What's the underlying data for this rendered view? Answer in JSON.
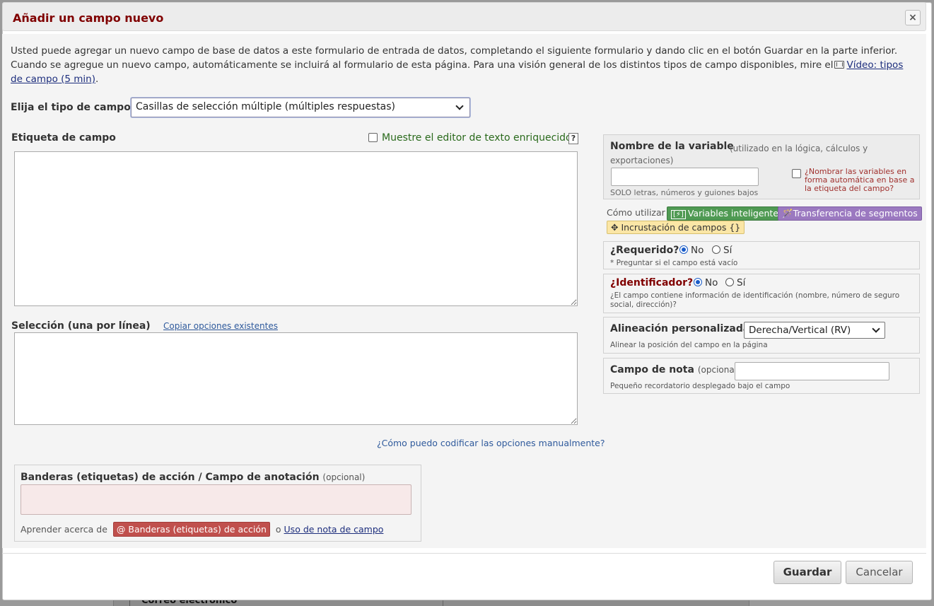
{
  "background": {
    "field_label": "Correo electrónico"
  },
  "dialog": {
    "title": "Añadir un campo nuevo",
    "close_label": "×"
  },
  "intro": {
    "line1": "Usted puede agregar un nuevo campo de base de datos a este formulario de entrada de datos, completando el siguiente formulario y dando clic en el botón Guardar en la parte inferior.",
    "line2": "Cuando se agregue un nuevo campo, automáticamente se incluirá al formulario de esta página. Para una visión general de los distintos tipos de campo disponibles, mire el",
    "video_link": "Vídeo: tipos de campo (5 min)",
    "trailing": "."
  },
  "field_type": {
    "label": "Elija el tipo de campo",
    "selected": "Casillas de selección múltiple (múltiples respuestas)"
  },
  "field_label": {
    "title": "Etiqueta de campo",
    "rich_text_label": "Muestre el editor de texto enriquecido",
    "help": "?",
    "value": ""
  },
  "choices": {
    "title": "Selección (una por línea)",
    "copy_link": "Copiar opciones existentes",
    "manual_link": "¿Cómo puedo codificar las opciones manualmente?",
    "value": ""
  },
  "action_tags": {
    "title_part1": "Banderas (etiquetas) de acción",
    "title_sep": " / ",
    "title_part2": "Campo de anotación",
    "optional": "(opcional)",
    "learn_prefix": "Aprender acerca de",
    "badge": "@ Banderas (etiquetas) de acción",
    "or": "o",
    "field_note_link": "Uso de nota de campo"
  },
  "variable": {
    "title": "Nombre de la variable",
    "hint_line1": "(utilizado en la lógica, cálculos y",
    "hint_line2": "exportaciones)",
    "value": "",
    "sub": "SOLO letras, números y guiones bajos",
    "auto_name": "¿Nombrar las variables en forma automática en base a la etiqueta del campo?"
  },
  "howto": {
    "label": "Cómo utilizar",
    "smart_vars": "Variables inteligentes",
    "smart_icon": "[⚡]",
    "piping": "Transferencia de segmentos",
    "piping_icon": "magic-wand-icon",
    "embedding": "Incrustación de campos {}",
    "embedding_icon": "move-arrows-icon"
  },
  "required": {
    "title": "¿Requerido?",
    "no": "No",
    "yes": "Sí",
    "selected": "No",
    "sub": "* Preguntar si el campo está vacío"
  },
  "identifier": {
    "title": "¿Identificador?",
    "no": "No",
    "yes": "Sí",
    "selected": "No",
    "sub": "¿El campo contiene información de identificación (nombre, número de seguro social, dirección)?"
  },
  "alignment": {
    "title": "Alineación personalizada",
    "selected": "Derecha/Vertical (RV)",
    "sub": "Alinear la posición del campo en la página"
  },
  "note": {
    "title": "Campo de nota",
    "optional": "(opcional)",
    "value": "",
    "sub": "Pequeño recordatorio desplegado bajo el campo"
  },
  "footer": {
    "save": "Guardar",
    "cancel": "Cancelar"
  },
  "colors": {
    "title_red": "#800000",
    "smart_green": "#4f9a53",
    "piping_purple": "#9b79c0",
    "embed_yellow": "#fbe6a6",
    "action_red": "#c0504d"
  }
}
